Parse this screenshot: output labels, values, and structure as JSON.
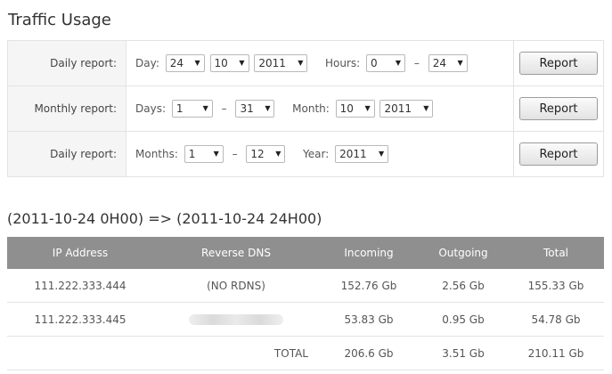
{
  "page_title": "Traffic Usage",
  "filters": {
    "daily": {
      "label": "Daily report:",
      "day_label": "Day:",
      "day": "24",
      "month": "10",
      "year": "2011",
      "hours_label": "Hours:",
      "hour_from": "0",
      "dash": "–",
      "hour_to": "24",
      "button": "Report"
    },
    "monthly": {
      "label": "Monthly report:",
      "days_label": "Days:",
      "day_from": "1",
      "dash": "–",
      "day_to": "31",
      "month_label": "Month:",
      "month": "10",
      "year": "2011",
      "button": "Report"
    },
    "yearly": {
      "label": "Daily report:",
      "months_label": "Months:",
      "month_from": "1",
      "dash": "–",
      "month_to": "12",
      "year_label": "Year:",
      "year": "2011",
      "button": "Report"
    }
  },
  "range_title": "(2011-10-24 0H00) => (2011-10-24 24H00)",
  "table": {
    "headers": [
      "IP Address",
      "Reverse DNS",
      "Incoming",
      "Outgoing",
      "Total"
    ],
    "rows": [
      {
        "ip": "111.222.333.444",
        "rdns": "(NO RDNS)",
        "incoming": "152.76 Gb",
        "outgoing": "2.56 Gb",
        "total": "155.33 Gb"
      },
      {
        "ip": "111.222.333.445",
        "rdns": "",
        "incoming": "53.83 Gb",
        "outgoing": "0.95 Gb",
        "total": "54.78 Gb"
      }
    ],
    "totals": {
      "label": "TOTAL",
      "incoming": "206.6 Gb",
      "outgoing": "3.51 Gb",
      "total": "210.11 Gb"
    }
  }
}
